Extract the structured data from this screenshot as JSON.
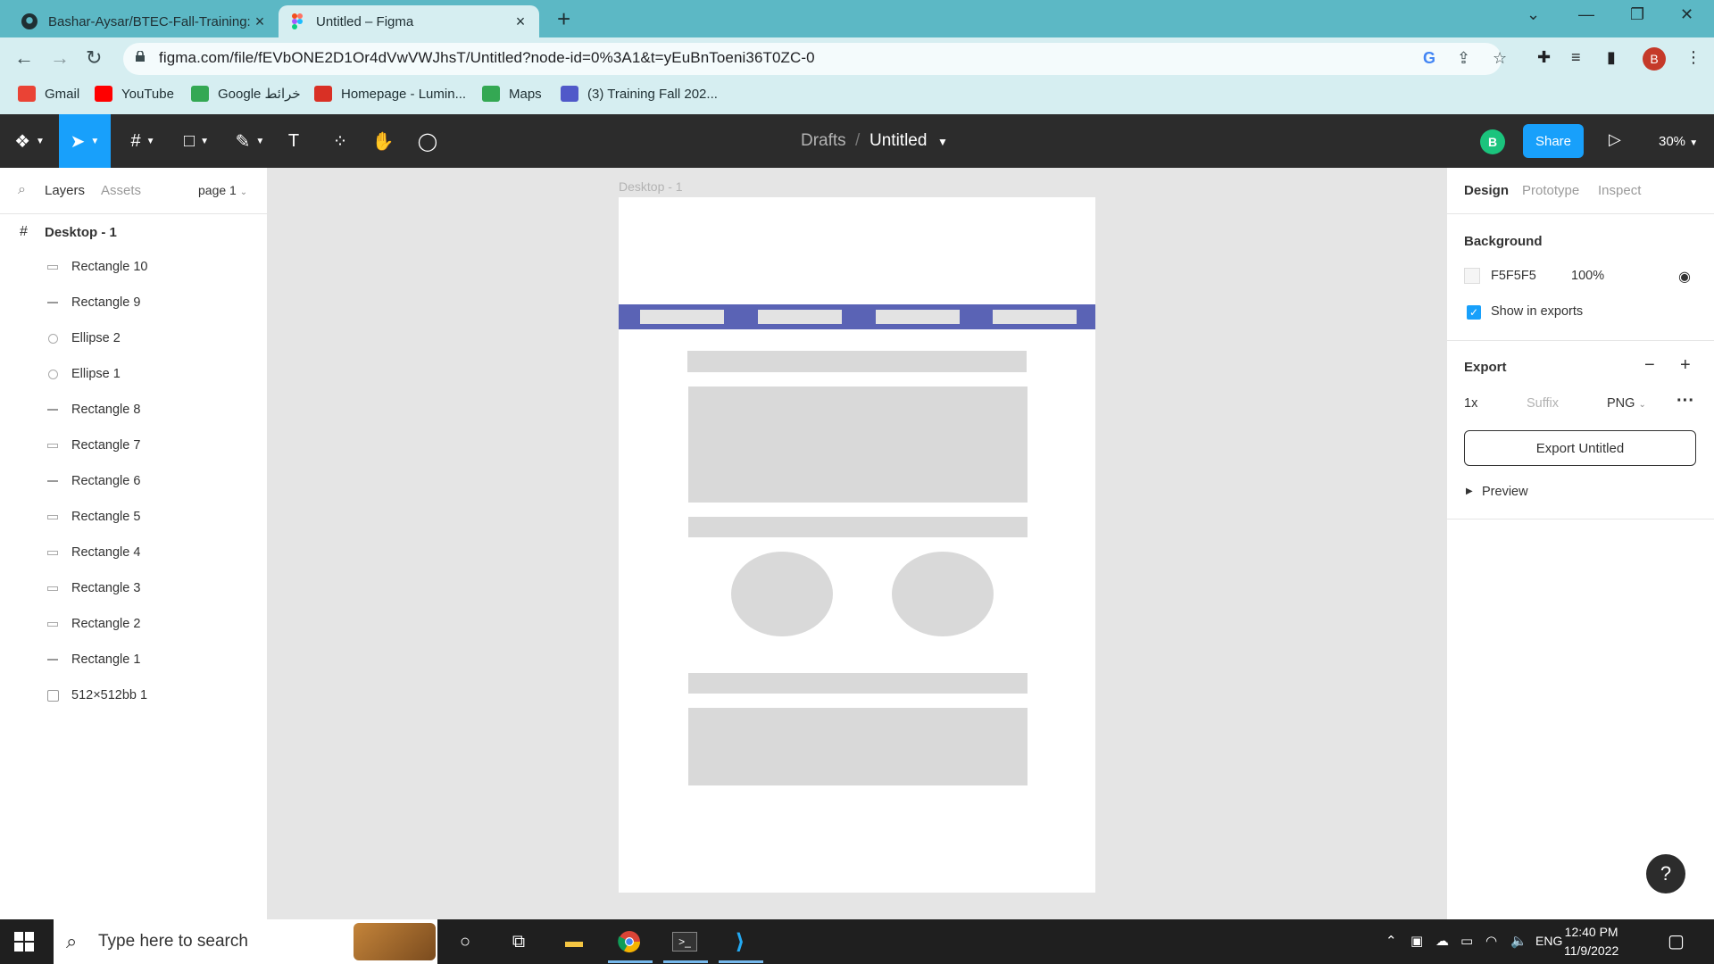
{
  "browser": {
    "tabs": [
      {
        "title": "Bashar-Aysar/BTEC-Fall-Training:",
        "close": "×"
      },
      {
        "title": "Untitled – Figma",
        "close": "×"
      }
    ],
    "new_tab": "+",
    "url": "figma.com/file/fEVbONE2D1Or4dVwVWJhsT/Untitled?node-id=0%3A1&t=yEuBnToeni36T0ZC-0",
    "profile_initial": "B",
    "bookmarks": [
      {
        "label": "Gmail",
        "color": "#ea4335"
      },
      {
        "label": "YouTube",
        "color": "#ff0000"
      },
      {
        "label": "Google خرائط",
        "color": "#34a853"
      },
      {
        "label": "Homepage - Lumin...",
        "color": "#d93025"
      },
      {
        "label": "Maps",
        "color": "#34a853"
      },
      {
        "label": "(3) Training Fall 202...",
        "color": "#5059c9"
      }
    ]
  },
  "figma": {
    "breadcrumb": {
      "folder": "Drafts",
      "separator": "/",
      "file": "Untitled"
    },
    "user_initial": "B",
    "share_label": "Share",
    "zoom": "30%",
    "left_panel": {
      "tabs": [
        "Layers",
        "Assets"
      ],
      "page": "page 1",
      "frame": "Desktop - 1",
      "layers": [
        {
          "name": "Rectangle 10",
          "icon": "rect"
        },
        {
          "name": "Rectangle 9",
          "icon": "line"
        },
        {
          "name": "Ellipse 2",
          "icon": "ellipse"
        },
        {
          "name": "Ellipse 1",
          "icon": "ellipse"
        },
        {
          "name": "Rectangle 8",
          "icon": "line"
        },
        {
          "name": "Rectangle 7",
          "icon": "rect"
        },
        {
          "name": "Rectangle 6",
          "icon": "line"
        },
        {
          "name": "Rectangle 5",
          "icon": "rect"
        },
        {
          "name": "Rectangle 4",
          "icon": "rect"
        },
        {
          "name": "Rectangle 3",
          "icon": "rect"
        },
        {
          "name": "Rectangle 2",
          "icon": "rect"
        },
        {
          "name": "Rectangle 1",
          "icon": "line"
        },
        {
          "name": "512×512bb 1",
          "icon": "image"
        }
      ]
    },
    "canvas": {
      "frame_label": "Desktop - 1",
      "nav_color": "#5a63b5",
      "shape_color": "#d9d9d9"
    },
    "right_panel": {
      "tabs": [
        "Design",
        "Prototype",
        "Inspect"
      ],
      "background": {
        "heading": "Background",
        "hex": "F5F5F5",
        "opacity": "100%",
        "show_in_exports": "Show in exports"
      },
      "export": {
        "heading": "Export",
        "scale": "1x",
        "suffix_placeholder": "Suffix",
        "format": "PNG",
        "button": "Export Untitled",
        "preview": "Preview"
      }
    },
    "help": "?"
  },
  "taskbar": {
    "search_placeholder": "Type here to search",
    "lang": "ENG",
    "time": "12:40 PM",
    "date": "11/9/2022"
  }
}
